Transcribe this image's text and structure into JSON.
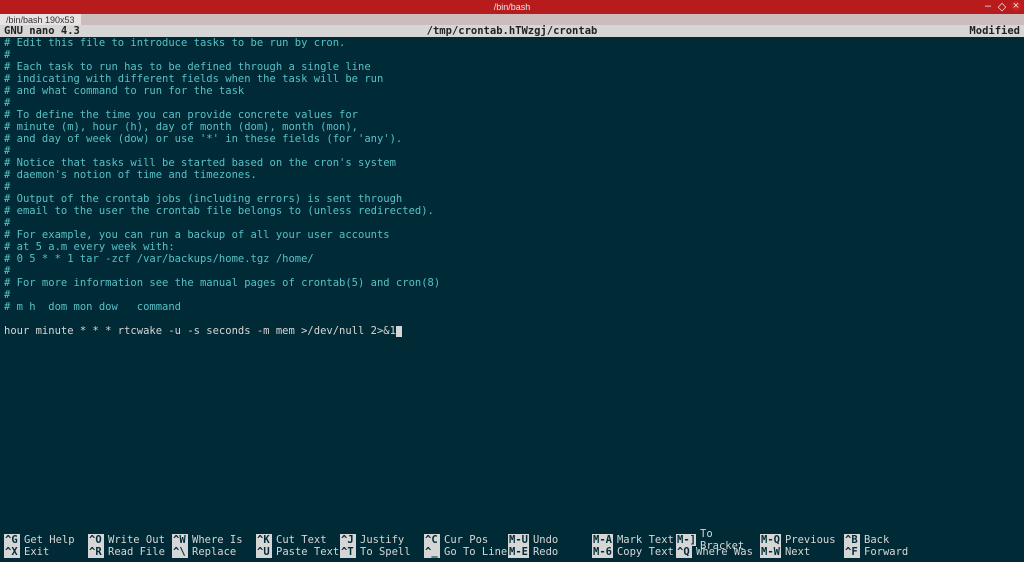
{
  "titlebar": {
    "title": "/bin/bash"
  },
  "tabbar": {
    "tab": "/bin/bash 190x53"
  },
  "nano_header": {
    "left": "GNU nano 4.3",
    "center": "/tmp/crontab.hTWzgj/crontab",
    "right": "Modified"
  },
  "editor_lines": [
    "# Edit this file to introduce tasks to be run by cron.",
    "#",
    "# Each task to run has to be defined through a single line",
    "# indicating with different fields when the task will be run",
    "# and what command to run for the task",
    "#",
    "# To define the time you can provide concrete values for",
    "# minute (m), hour (h), day of month (dom), month (mon),",
    "# and day of week (dow) or use '*' in these fields (for 'any').",
    "#",
    "# Notice that tasks will be started based on the cron's system",
    "# daemon's notion of time and timezones.",
    "#",
    "# Output of the crontab jobs (including errors) is sent through",
    "# email to the user the crontab file belongs to (unless redirected).",
    "#",
    "# For example, you can run a backup of all your user accounts",
    "# at 5 a.m every week with:",
    "# 0 5 * * 1 tar -zcf /var/backups/home.tgz /home/",
    "#",
    "# For more information see the manual pages of crontab(5) and cron(8)",
    "#",
    "# m h  dom mon dow   command"
  ],
  "user_line": "hour minute * * * rtcwake -u -s seconds -m mem >/dev/null 2>&1",
  "shortcuts": [
    [
      {
        "key": "^G",
        "label": "Get Help"
      },
      {
        "key": "^X",
        "label": "Exit"
      }
    ],
    [
      {
        "key": "^O",
        "label": "Write Out"
      },
      {
        "key": "^R",
        "label": "Read File"
      }
    ],
    [
      {
        "key": "^W",
        "label": "Where Is"
      },
      {
        "key": "^\\",
        "label": "Replace"
      }
    ],
    [
      {
        "key": "^K",
        "label": "Cut Text"
      },
      {
        "key": "^U",
        "label": "Paste Text"
      }
    ],
    [
      {
        "key": "^J",
        "label": "Justify"
      },
      {
        "key": "^T",
        "label": "To Spell"
      }
    ],
    [
      {
        "key": "^C",
        "label": "Cur Pos"
      },
      {
        "key": "^_",
        "label": "Go To Line"
      }
    ],
    [
      {
        "key": "M-U",
        "label": "Undo"
      },
      {
        "key": "M-E",
        "label": "Redo"
      }
    ],
    [
      {
        "key": "M-A",
        "label": "Mark Text"
      },
      {
        "key": "M-6",
        "label": "Copy Text"
      }
    ],
    [
      {
        "key": "M-]",
        "label": "To Bracket"
      },
      {
        "key": "^Q",
        "label": "Where Was"
      }
    ],
    [
      {
        "key": "M-Q",
        "label": "Previous"
      },
      {
        "key": "M-W",
        "label": "Next"
      }
    ],
    [
      {
        "key": "^B",
        "label": "Back"
      },
      {
        "key": "^F",
        "label": "Forward"
      }
    ]
  ]
}
